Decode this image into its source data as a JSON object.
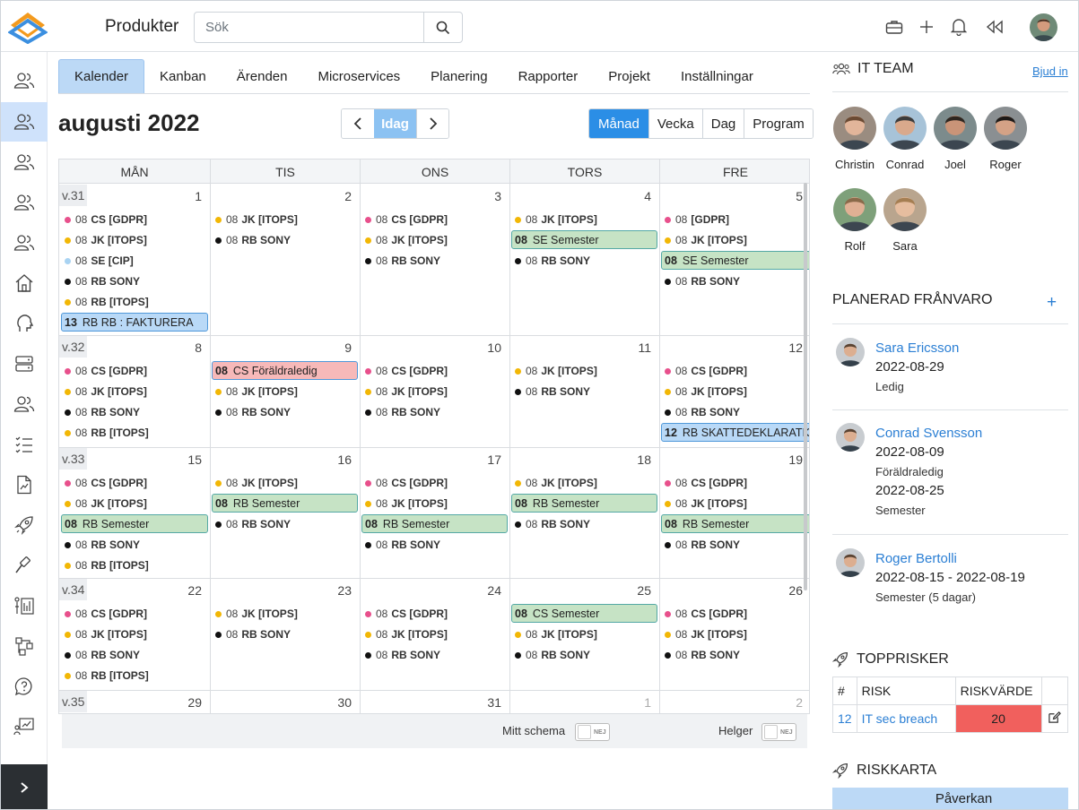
{
  "header": {
    "title": "Produkter",
    "search_placeholder": "Sök"
  },
  "tabs": [
    "Kalender",
    "Kanban",
    "Ärenden",
    "Microservices",
    "Planering",
    "Rapporter",
    "Projekt",
    "Inställningar"
  ],
  "toolbar": {
    "month": "augusti 2022",
    "today": "Idag",
    "views": [
      "Månad",
      "Vecka",
      "Dag",
      "Program"
    ]
  },
  "calendar": {
    "daynames": [
      "MÅN",
      "TIS",
      "ONS",
      "TORS",
      "FRE"
    ],
    "weeks": [
      {
        "label": "v.31",
        "days": [
          {
            "num": "1",
            "events": [
              {
                "t": "08",
                "n": "CS [GDPR]",
                "c": "#e8508c"
              },
              {
                "t": "08",
                "n": "JK [ITOPS]",
                "c": "#f2b705"
              },
              {
                "t": "08",
                "n": "SE [CIP]",
                "c": "#a9d3f2"
              },
              {
                "t": "08",
                "n": "RB SONY",
                "c": "#111"
              },
              {
                "t": "08",
                "n": "RB [ITOPS]",
                "c": "#f2b705"
              }
            ],
            "bars": [
              {
                "t": "13",
                "n": "RB RB : FAKTURERA",
                "k": "blue",
                "slot": 5
              }
            ]
          },
          {
            "num": "2",
            "events": [
              {
                "t": "08",
                "n": "JK [ITOPS]",
                "c": "#f2b705"
              },
              {
                "t": "08",
                "n": "RB SONY",
                "c": "#111"
              }
            ],
            "bars": []
          },
          {
            "num": "3",
            "events": [
              {
                "t": "08",
                "n": "CS [GDPR]",
                "c": "#e8508c"
              },
              {
                "t": "08",
                "n": "JK [ITOPS]",
                "c": "#f2b705"
              },
              {
                "t": "08",
                "n": "RB SONY",
                "c": "#111"
              }
            ],
            "bars": []
          },
          {
            "num": "4",
            "events": [
              {
                "t": "08",
                "n": "JK [ITOPS]",
                "c": "#f2b705"
              },
              {
                "t": "08",
                "n": "RB SONY",
                "c": "#111",
                "slot": 2
              }
            ],
            "bars": [
              {
                "t": "08",
                "n": "SE Semester",
                "k": "green",
                "slot": 1
              }
            ]
          },
          {
            "num": "5",
            "events": [
              {
                "t": "08",
                "n": "[GDPR]",
                "c": "#e8508c"
              },
              {
                "t": "08",
                "n": "JK [ITOPS]",
                "c": "#f2b705"
              },
              {
                "t": "08",
                "n": "RB SONY",
                "c": "#111",
                "slot": 3
              }
            ],
            "bars": [
              {
                "t": "08",
                "n": "SE Semester",
                "k": "green",
                "slot": 2
              }
            ]
          }
        ]
      },
      {
        "label": "v.32",
        "days": [
          {
            "num": "8",
            "events": [
              {
                "t": "08",
                "n": "CS [GDPR]",
                "c": "#e8508c"
              },
              {
                "t": "08",
                "n": "JK [ITOPS]",
                "c": "#f2b705"
              },
              {
                "t": "08",
                "n": "RB SONY",
                "c": "#111"
              },
              {
                "t": "08",
                "n": "RB [ITOPS]",
                "c": "#f2b705"
              }
            ],
            "bars": []
          },
          {
            "num": "9",
            "events": [
              {
                "t": "08",
                "n": "JK [ITOPS]",
                "c": "#f2b705",
                "slot": 1
              },
              {
                "t": "08",
                "n": "RB SONY",
                "c": "#111",
                "slot": 2
              }
            ],
            "bars": [
              {
                "t": "08",
                "n": "CS Föräldraledig",
                "k": "red",
                "slot": 0
              }
            ]
          },
          {
            "num": "10",
            "events": [
              {
                "t": "08",
                "n": "CS [GDPR]",
                "c": "#e8508c"
              },
              {
                "t": "08",
                "n": "JK [ITOPS]",
                "c": "#f2b705"
              },
              {
                "t": "08",
                "n": "RB SONY",
                "c": "#111"
              }
            ],
            "bars": []
          },
          {
            "num": "11",
            "events": [
              {
                "t": "08",
                "n": "JK [ITOPS]",
                "c": "#f2b705"
              },
              {
                "t": "08",
                "n": "RB SONY",
                "c": "#111"
              }
            ],
            "bars": []
          },
          {
            "num": "12",
            "events": [
              {
                "t": "08",
                "n": "CS [GDPR]",
                "c": "#e8508c"
              },
              {
                "t": "08",
                "n": "JK [ITOPS]",
                "c": "#f2b705"
              },
              {
                "t": "08",
                "n": "RB SONY",
                "c": "#111"
              }
            ],
            "bars": [
              {
                "t": "12",
                "n": "RB SKATTEDEKLARATION",
                "k": "blue",
                "slot": 3
              }
            ]
          }
        ]
      },
      {
        "label": "v.33",
        "days": [
          {
            "num": "15",
            "events": [
              {
                "t": "08",
                "n": "CS [GDPR]",
                "c": "#e8508c"
              },
              {
                "t": "08",
                "n": "JK [ITOPS]",
                "c": "#f2b705"
              },
              {
                "t": "08",
                "n": "RB SONY",
                "c": "#111",
                "slot": 3
              },
              {
                "t": "08",
                "n": "RB [ITOPS]",
                "c": "#f2b705",
                "slot": 4
              }
            ],
            "bars": [
              {
                "t": "08",
                "n": "RB Semester",
                "k": "green",
                "slot": 2
              }
            ]
          },
          {
            "num": "16",
            "events": [
              {
                "t": "08",
                "n": "JK [ITOPS]",
                "c": "#f2b705"
              },
              {
                "t": "08",
                "n": "RB SONY",
                "c": "#111",
                "slot": 2
              }
            ],
            "bars": [
              {
                "t": "08",
                "n": "RB Semester",
                "k": "green",
                "slot": 1
              }
            ]
          },
          {
            "num": "17",
            "events": [
              {
                "t": "08",
                "n": "CS [GDPR]",
                "c": "#e8508c"
              },
              {
                "t": "08",
                "n": "JK [ITOPS]",
                "c": "#f2b705"
              },
              {
                "t": "08",
                "n": "RB SONY",
                "c": "#111",
                "slot": 3
              }
            ],
            "bars": [
              {
                "t": "08",
                "n": "RB Semester",
                "k": "green",
                "slot": 2
              }
            ]
          },
          {
            "num": "18",
            "events": [
              {
                "t": "08",
                "n": "JK [ITOPS]",
                "c": "#f2b705"
              },
              {
                "t": "08",
                "n": "RB SONY",
                "c": "#111",
                "slot": 2
              }
            ],
            "bars": [
              {
                "t": "08",
                "n": "RB Semester",
                "k": "green",
                "slot": 1
              }
            ]
          },
          {
            "num": "19",
            "events": [
              {
                "t": "08",
                "n": "CS [GDPR]",
                "c": "#e8508c"
              },
              {
                "t": "08",
                "n": "JK [ITOPS]",
                "c": "#f2b705"
              },
              {
                "t": "08",
                "n": "RB SONY",
                "c": "#111",
                "slot": 3
              }
            ],
            "bars": [
              {
                "t": "08",
                "n": "RB Semester",
                "k": "green",
                "slot": 2
              }
            ]
          }
        ]
      },
      {
        "label": "v.34",
        "days": [
          {
            "num": "22",
            "events": [
              {
                "t": "08",
                "n": "CS [GDPR]",
                "c": "#e8508c"
              },
              {
                "t": "08",
                "n": "JK [ITOPS]",
                "c": "#f2b705"
              },
              {
                "t": "08",
                "n": "RB SONY",
                "c": "#111"
              },
              {
                "t": "08",
                "n": "RB [ITOPS]",
                "c": "#f2b705"
              }
            ],
            "bars": []
          },
          {
            "num": "23",
            "events": [
              {
                "t": "08",
                "n": "JK [ITOPS]",
                "c": "#f2b705"
              },
              {
                "t": "08",
                "n": "RB SONY",
                "c": "#111"
              }
            ],
            "bars": []
          },
          {
            "num": "24",
            "events": [
              {
                "t": "08",
                "n": "CS [GDPR]",
                "c": "#e8508c"
              },
              {
                "t": "08",
                "n": "JK [ITOPS]",
                "c": "#f2b705"
              },
              {
                "t": "08",
                "n": "RB SONY",
                "c": "#111"
              }
            ],
            "bars": []
          },
          {
            "num": "25",
            "events": [
              {
                "t": "08",
                "n": "JK [ITOPS]",
                "c": "#f2b705",
                "slot": 1
              },
              {
                "t": "08",
                "n": "RB SONY",
                "c": "#111",
                "slot": 2
              }
            ],
            "bars": [
              {
                "t": "08",
                "n": "CS Semester",
                "k": "green",
                "slot": 0
              }
            ]
          },
          {
            "num": "26",
            "events": [
              {
                "t": "08",
                "n": "CS [GDPR]",
                "c": "#e8508c"
              },
              {
                "t": "08",
                "n": "JK [ITOPS]",
                "c": "#f2b705"
              },
              {
                "t": "08",
                "n": "RB SONY",
                "c": "#111"
              }
            ],
            "bars": []
          }
        ]
      },
      {
        "label": "v.35",
        "days": [
          {
            "num": "29",
            "events": [],
            "bars": []
          },
          {
            "num": "30",
            "events": [],
            "bars": []
          },
          {
            "num": "31",
            "events": [],
            "bars": []
          },
          {
            "num": "1",
            "other": true,
            "events": [],
            "bars": []
          },
          {
            "num": "2",
            "other": true,
            "events": [],
            "bars": []
          }
        ]
      }
    ]
  },
  "footer": {
    "my_schedule": "Mitt schema",
    "weekends": "Helger",
    "toggle_off": "NEJ"
  },
  "team": {
    "title": "IT TEAM",
    "invite": "Bjud in",
    "members": [
      "Christin",
      "Conrad",
      "Joel",
      "Roger",
      "Rolf",
      "Sara"
    ]
  },
  "absence": {
    "title": "PLANERAD FRÅNVARO",
    "entries": [
      {
        "name": "Sara Ericsson",
        "date1": "2022-08-29",
        "kind1": "Ledig"
      },
      {
        "name": "Conrad Svensson",
        "date1": "2022-08-09",
        "kind1": "Föräldraledig",
        "date2": "2022-08-25",
        "kind2": "Semester"
      },
      {
        "name": "Roger Bertolli",
        "date1": "2022-08-15 - 2022-08-19",
        "kind1": "Semester (5 dagar)"
      }
    ]
  },
  "risks": {
    "title": "TOPPRISKER",
    "headers": [
      "#",
      "RISK",
      "RISKVÄRDE"
    ],
    "rows": [
      {
        "id": "12",
        "name": "IT sec breach",
        "value": "20"
      }
    ]
  },
  "riskmap": {
    "title": "RISKKARTA",
    "impact": "Påverkan"
  }
}
